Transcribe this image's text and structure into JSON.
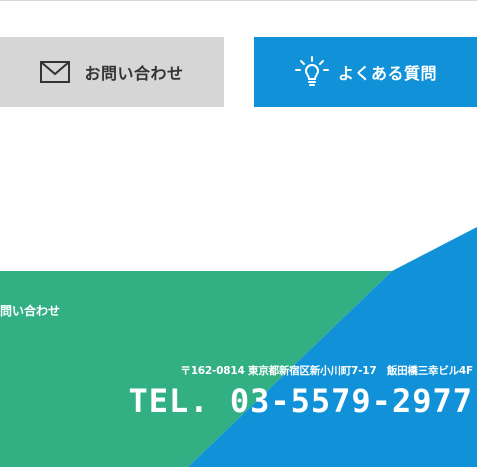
{
  "buttons": {
    "contact_label": "お問い合わせ",
    "faq_label": "よくある質問"
  },
  "footer": {
    "contact_link": "問い合わせ",
    "address": "〒162-0814 東京都新宿区新小川町7-17　飯田橋三幸ビル4F",
    "tel": "TEL. 03-5579-2977"
  },
  "colors": {
    "contact_button_bg": "#d6d6d6",
    "faq_button_bg": "#1192d8",
    "footer_green": "#33b083",
    "footer_blue": "#1192d8"
  },
  "icons": {
    "contact": "mail-icon",
    "faq": "lightbulb-icon"
  }
}
